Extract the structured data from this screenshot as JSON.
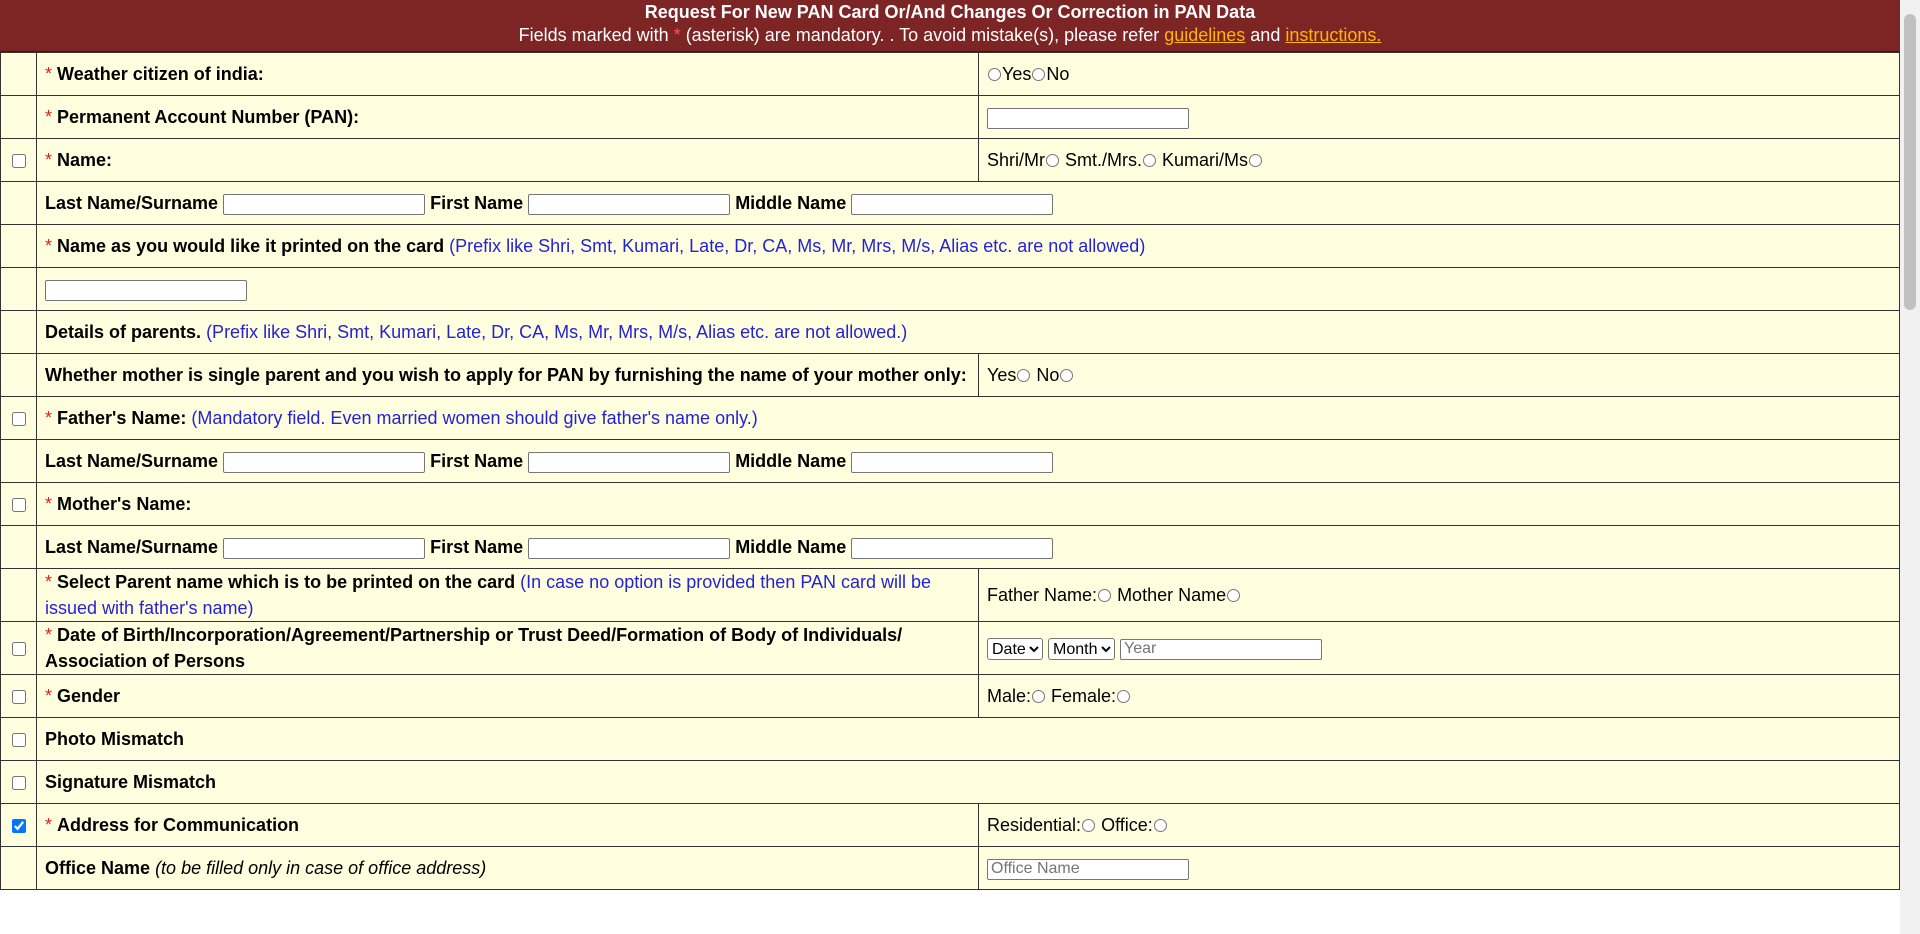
{
  "header": {
    "title": "Request For New PAN Card Or/And Changes Or Correction in PAN Data",
    "sub_prefix": "Fields marked with",
    "sub_star": "*",
    "sub_middle": "(asterisk) are mandatory. . To avoid mistake(s), please refer",
    "guidelines": "guidelines",
    "and": "and",
    "instructions": "instructions."
  },
  "star": "*",
  "rows": {
    "citizen": {
      "label": "Weather citizen of india:",
      "yes": "Yes",
      "no": "No"
    },
    "pan": {
      "label": "Permanent Account Number (PAN):"
    },
    "name": {
      "label": "Name:",
      "shri": "Shri/Mr",
      "smt": "Smt./Mrs.",
      "kumari": "Kumari/Ms"
    },
    "fields": {
      "last": "Last Name/Surname",
      "first": "First Name",
      "middle": "Middle Name"
    },
    "print_name": {
      "label": "Name as you would like it printed on the card",
      "note": "(Prefix like Shri, Smt, Kumari, Late, Dr, CA, Ms, Mr, Mrs, M/s, Alias etc. are not allowed)"
    },
    "parents": {
      "label": "Details of parents.",
      "note": "(Prefix like Shri, Smt, Kumari, Late, Dr, CA, Ms, Mr, Mrs, M/s, Alias etc. are not allowed.)"
    },
    "single_parent": {
      "label": "Whether mother is single parent and you wish to apply for PAN by furnishing the name of your mother only:",
      "yes": "Yes",
      "no": "No"
    },
    "father": {
      "label": "Father's Name:",
      "note": "(Mandatory field. Even married women should give father's name only.)"
    },
    "mother": {
      "label": "Mother's Name:"
    },
    "parent_print": {
      "label": "Select Parent name which is to be printed on the card",
      "note": "(In case no option is provided then PAN card will be issued with father's name)",
      "father": "Father Name:",
      "mother": "Mother Name"
    },
    "dob": {
      "label": "Date of Birth/Incorporation/Agreement/Partnership or Trust Deed/Formation of Body of Individuals/ Association of Persons",
      "date": "Date",
      "month": "Month",
      "year_placeholder": "Year"
    },
    "gender": {
      "label": "Gender",
      "male": "Male:",
      "female": "Female:"
    },
    "photo": {
      "label": "Photo Mismatch"
    },
    "signature": {
      "label": "Signature Mismatch"
    },
    "address": {
      "label": "Address for Communication",
      "residential": "Residential:",
      "office": "Office:",
      "checked": true
    },
    "office_name": {
      "label": "Office Name",
      "note": "(to be filled only in case of office address)",
      "placeholder": "Office Name"
    }
  }
}
